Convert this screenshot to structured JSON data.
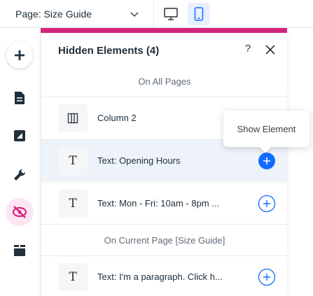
{
  "topbar": {
    "page_label": "Page:",
    "page_value": "Size Guide",
    "view_modes": [
      "desktop",
      "mobile"
    ],
    "active_view": "mobile"
  },
  "sidebar": {
    "items": [
      {
        "icon": "plus-icon"
      },
      {
        "icon": "page-icon"
      },
      {
        "icon": "design-icon"
      },
      {
        "icon": "wrench-icon"
      },
      {
        "icon": "hidden-eye-icon",
        "active": true
      },
      {
        "icon": "layout-icon"
      }
    ]
  },
  "panel": {
    "title": "Hidden Elements (4)",
    "help": "?",
    "section_all": "On All Pages",
    "section_current": "On Current Page [Size Guide]",
    "rows": [
      {
        "type_icon": "column-icon",
        "name": "Column 2"
      },
      {
        "type_icon": "T",
        "name": "Text: Opening Hours"
      },
      {
        "type_icon": "T",
        "name": "Text: Mon - Fri: 10am - 8pm ..."
      },
      {
        "type_icon": "T",
        "name": "Text: I'm a paragraph. Click h..."
      }
    ]
  },
  "tooltip": {
    "text": "Show Element"
  },
  "colors": {
    "accent": "#116dff",
    "brand_strip": "#d6257d",
    "active_bg": "#fde6f4",
    "hover_row": "#eef3f9"
  }
}
